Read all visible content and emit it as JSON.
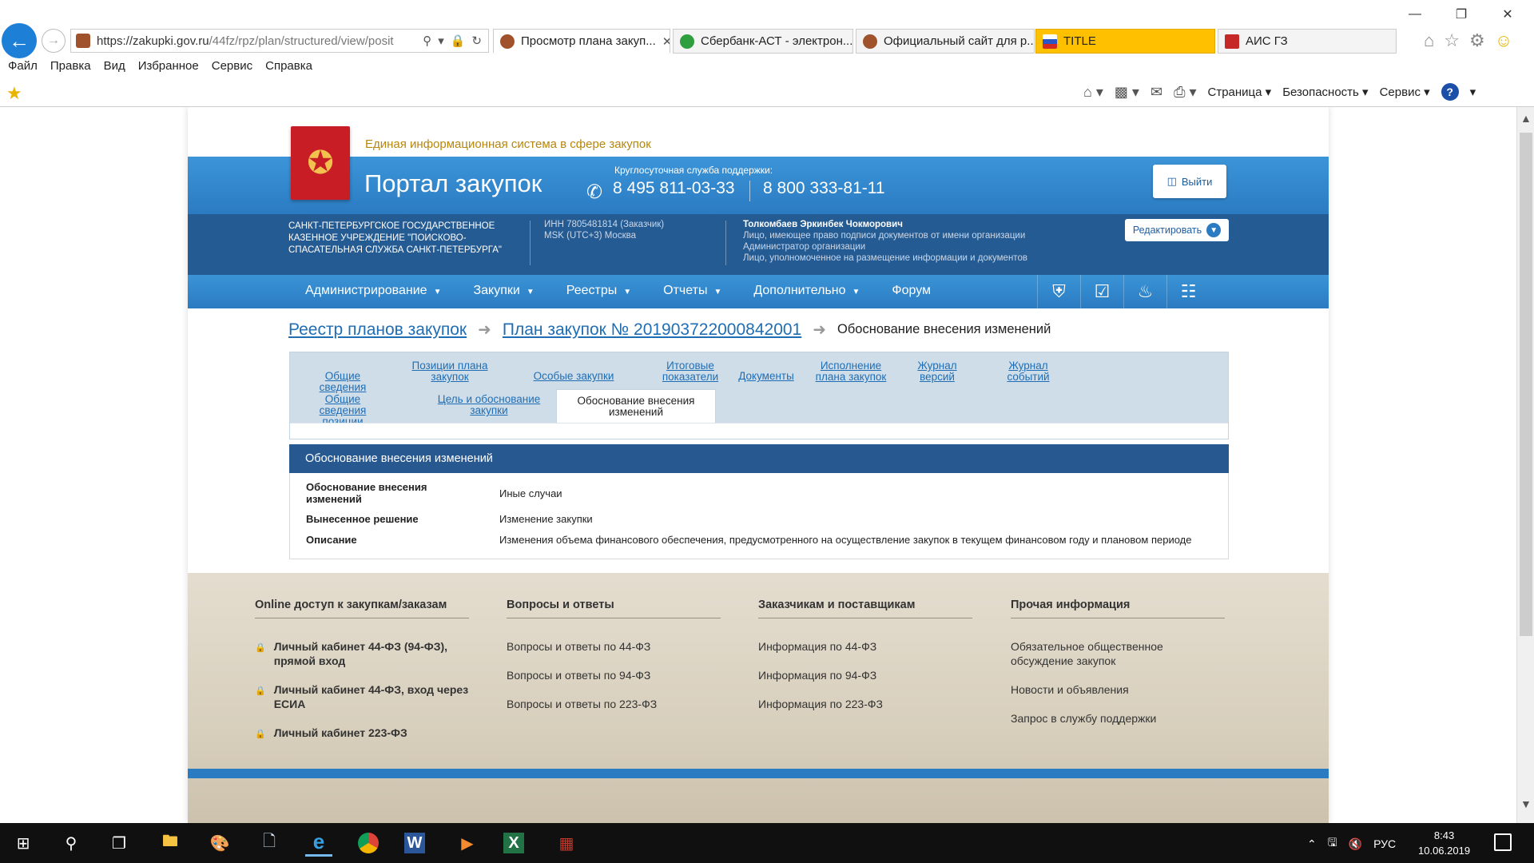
{
  "browser": {
    "window_controls": {
      "minimize": "—",
      "restore": "❐",
      "close": "✕"
    },
    "address": {
      "url_host": "https://zakupki.gov.ru",
      "url_path": "/44fz/rpz/plan/structured/view/posit"
    },
    "tabs": [
      {
        "title": "Просмотр плана закуп...",
        "close": "✕"
      },
      {
        "title": "Сбербанк-АСТ - электрон..."
      },
      {
        "title": "Официальный сайт для р..."
      },
      {
        "title": "TITLE"
      },
      {
        "title": "АИС ГЗ"
      }
    ],
    "menu": [
      "Файл",
      "Правка",
      "Вид",
      "Избранное",
      "Сервис",
      "Справка"
    ],
    "command_bar": {
      "page": "Страница",
      "safety": "Безопасность",
      "tools": "Сервис"
    }
  },
  "site": {
    "eis_title": "Единая информационная система в сфере закупок",
    "portal_title": "Портал закупок",
    "support_label": "Круглосуточная служба поддержки:",
    "phone1": "8 495 811-03-33",
    "phone2": "8 800 333-81-11",
    "logout": "Выйти",
    "org": {
      "name": "САНКТ-ПЕТЕРБУРГСКОЕ ГОСУДАРСТВЕННОЕ КАЗЕННОЕ УЧРЕЖДЕНИЕ \"ПОИСКОВО-СПАСАТЕЛЬНАЯ СЛУЖБА САНКТ-ПЕТЕРБУРГА\"",
      "inn": "ИНН 7805481814 (Заказчик)",
      "tz": "MSK (UTC+3) Москва",
      "user": "Толкомбаев Эркинбек Чокморович",
      "roles": [
        "Лицо, имеющее право подписи документов от имени организации",
        "Администратор организации",
        "Лицо, уполномоченное на размещение информации и документов"
      ],
      "edit": "Редактировать"
    },
    "nav": [
      "Администрирование",
      "Закупки",
      "Реестры",
      "Отчеты",
      "Дополнительно",
      "Форум"
    ],
    "breadcrumb": {
      "link1": "Реестр планов закупок",
      "link2": "План закупок № 201903722000842001",
      "current": "Обоснование внесения изменений"
    },
    "tabs_row1": [
      "Общие сведения",
      "Позиции плана закупок",
      "Особые закупки",
      "Итоговые показатели",
      "Документы",
      "Исполнение плана закупок",
      "Журнал версий",
      "Журнал событий"
    ],
    "tabs_row2": [
      "Общие сведения позиции",
      "Цель и обоснование закупки"
    ],
    "tab_current": "Обоснование внесения изменений",
    "section": {
      "title": "Обоснование внесения изменений",
      "rows": [
        {
          "label": "Обоснование внесения изменений",
          "value": "Иные случаи"
        },
        {
          "label": "Вынесенное решение",
          "value": "Изменение закупки"
        },
        {
          "label": "Описание",
          "value": "Изменения объема финансового обеспечения, предусмотренного на осуществление закупок в текущем финансовом году и плановом периоде"
        }
      ]
    },
    "footer": {
      "col1": {
        "title": "Online доступ к закупкам/заказам",
        "items": [
          "Личный кабинет 44-ФЗ (94-ФЗ), прямой вход",
          "Личный кабинет 44-ФЗ, вход через ЕСИА",
          "Личный кабинет 223-ФЗ"
        ]
      },
      "col2": {
        "title": "Вопросы и ответы",
        "items": [
          "Вопросы и ответы по 44-ФЗ",
          "Вопросы и ответы по 94-ФЗ",
          "Вопросы и ответы по 223-ФЗ"
        ]
      },
      "col3": {
        "title": "Заказчикам и поставщикам",
        "items": [
          "Информация по 44-ФЗ",
          "Информация по 94-ФЗ",
          "Информация по 223-ФЗ"
        ]
      },
      "col4": {
        "title": "Прочая информация",
        "items": [
          "Обязательное общественное обсуждение закупок",
          "Новости и объявления",
          "Запрос в службу поддержки"
        ]
      }
    }
  },
  "taskbar": {
    "lang": "РУС",
    "time": "8:43",
    "date": "10.06.2019",
    "apps": [
      "start-icon",
      "search-icon",
      "task-view-icon",
      "file-explorer-icon",
      "paint-icon",
      "notepad-icon",
      "internet-explorer-icon",
      "chrome-icon",
      "word-icon",
      "media-player-icon",
      "excel-icon",
      "winrar-icon"
    ]
  },
  "colors": {
    "accent_blue": "#2b7bc2",
    "dark_blue": "#255b93",
    "section_head": "#275990",
    "title_tab": "#ffc000",
    "emblem_red": "#c81d25"
  }
}
